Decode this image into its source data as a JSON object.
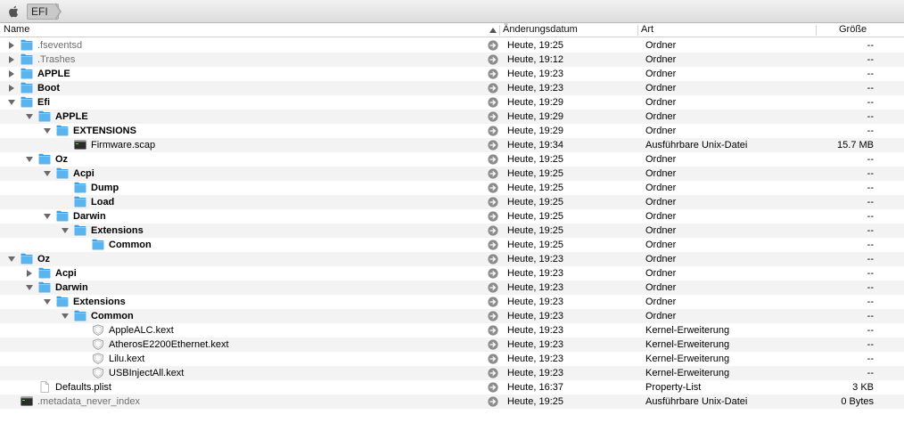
{
  "path": {
    "crumb": "EFI"
  },
  "columns": {
    "name": "Name",
    "date": "Änderungsdatum",
    "kind": "Art",
    "size": "Größe"
  },
  "rows": [
    {
      "depth": 0,
      "disc": "closed",
      "icon": "folder",
      "name": ".fseventsd",
      "style": "dim",
      "date": "Heute, 19:25",
      "kind": "Ordner",
      "size": "--"
    },
    {
      "depth": 0,
      "disc": "closed",
      "icon": "folder",
      "name": ".Trashes",
      "style": "dim",
      "date": "Heute, 19:12",
      "kind": "Ordner",
      "size": "--"
    },
    {
      "depth": 0,
      "disc": "closed",
      "icon": "folder",
      "name": "APPLE",
      "style": "bold",
      "date": "Heute, 19:23",
      "kind": "Ordner",
      "size": "--"
    },
    {
      "depth": 0,
      "disc": "closed",
      "icon": "folder",
      "name": "Boot",
      "style": "bold",
      "date": "Heute, 19:23",
      "kind": "Ordner",
      "size": "--"
    },
    {
      "depth": 0,
      "disc": "open",
      "icon": "folder",
      "name": "Efi",
      "style": "bold",
      "date": "Heute, 19:29",
      "kind": "Ordner",
      "size": "--"
    },
    {
      "depth": 1,
      "disc": "open",
      "icon": "folder",
      "name": "APPLE",
      "style": "bold",
      "date": "Heute, 19:29",
      "kind": "Ordner",
      "size": "--"
    },
    {
      "depth": 2,
      "disc": "open",
      "icon": "folder",
      "name": "EXTENSIONS",
      "style": "bold",
      "date": "Heute, 19:29",
      "kind": "Ordner",
      "size": "--"
    },
    {
      "depth": 3,
      "disc": "none",
      "icon": "exec",
      "name": "Firmware.scap",
      "style": "normal",
      "date": "Heute, 19:34",
      "kind": "Ausführbare Unix-Datei",
      "size": "15.7 MB"
    },
    {
      "depth": 1,
      "disc": "open",
      "icon": "folder",
      "name": "Oz",
      "style": "bold",
      "date": "Heute, 19:25",
      "kind": "Ordner",
      "size": "--"
    },
    {
      "depth": 2,
      "disc": "open",
      "icon": "folder",
      "name": "Acpi",
      "style": "bold",
      "date": "Heute, 19:25",
      "kind": "Ordner",
      "size": "--"
    },
    {
      "depth": 3,
      "disc": "none",
      "icon": "folder",
      "name": "Dump",
      "style": "bold",
      "date": "Heute, 19:25",
      "kind": "Ordner",
      "size": "--"
    },
    {
      "depth": 3,
      "disc": "none",
      "icon": "folder",
      "name": "Load",
      "style": "bold",
      "date": "Heute, 19:25",
      "kind": "Ordner",
      "size": "--"
    },
    {
      "depth": 2,
      "disc": "open",
      "icon": "folder",
      "name": "Darwin",
      "style": "bold",
      "date": "Heute, 19:25",
      "kind": "Ordner",
      "size": "--"
    },
    {
      "depth": 3,
      "disc": "open",
      "icon": "folder",
      "name": "Extensions",
      "style": "bold",
      "date": "Heute, 19:25",
      "kind": "Ordner",
      "size": "--"
    },
    {
      "depth": 4,
      "disc": "none",
      "icon": "folder",
      "name": "Common",
      "style": "bold",
      "date": "Heute, 19:25",
      "kind": "Ordner",
      "size": "--"
    },
    {
      "depth": 0,
      "disc": "open",
      "icon": "folder",
      "name": "Oz",
      "style": "bold",
      "date": "Heute, 19:23",
      "kind": "Ordner",
      "size": "--"
    },
    {
      "depth": 1,
      "disc": "closed",
      "icon": "folder",
      "name": "Acpi",
      "style": "bold",
      "date": "Heute, 19:23",
      "kind": "Ordner",
      "size": "--"
    },
    {
      "depth": 1,
      "disc": "open",
      "icon": "folder",
      "name": "Darwin",
      "style": "bold",
      "date": "Heute, 19:23",
      "kind": "Ordner",
      "size": "--"
    },
    {
      "depth": 2,
      "disc": "open",
      "icon": "folder",
      "name": "Extensions",
      "style": "bold",
      "date": "Heute, 19:23",
      "kind": "Ordner",
      "size": "--"
    },
    {
      "depth": 3,
      "disc": "open",
      "icon": "folder",
      "name": "Common",
      "style": "bold",
      "date": "Heute, 19:23",
      "kind": "Ordner",
      "size": "--"
    },
    {
      "depth": 4,
      "disc": "none",
      "icon": "kext",
      "name": "AppleALC.kext",
      "style": "normal",
      "date": "Heute, 19:23",
      "kind": "Kernel-Erweiterung",
      "size": "--"
    },
    {
      "depth": 4,
      "disc": "none",
      "icon": "kext",
      "name": "AtherosE2200Ethernet.kext",
      "style": "normal",
      "date": "Heute, 19:23",
      "kind": "Kernel-Erweiterung",
      "size": "--"
    },
    {
      "depth": 4,
      "disc": "none",
      "icon": "kext",
      "name": "Lilu.kext",
      "style": "normal",
      "date": "Heute, 19:23",
      "kind": "Kernel-Erweiterung",
      "size": "--"
    },
    {
      "depth": 4,
      "disc": "none",
      "icon": "kext",
      "name": "USBInjectAll.kext",
      "style": "normal",
      "date": "Heute, 19:23",
      "kind": "Kernel-Erweiterung",
      "size": "--"
    },
    {
      "depth": 1,
      "disc": "none",
      "icon": "doc",
      "name": "Defaults.plist",
      "style": "normal",
      "date": "Heute, 16:37",
      "kind": "Property-List",
      "size": "3 KB"
    },
    {
      "depth": 0,
      "disc": "none",
      "icon": "exec",
      "name": ".metadata_never_index",
      "style": "dim",
      "date": "Heute, 19:25",
      "kind": "Ausführbare Unix-Datei",
      "size": "0 Bytes"
    }
  ],
  "colors": {
    "folder": "#5bb4ee",
    "folder_tab": "#3f9fe0",
    "alt_row": "#f3f3f3",
    "dim_text": "#6e6e6e"
  }
}
